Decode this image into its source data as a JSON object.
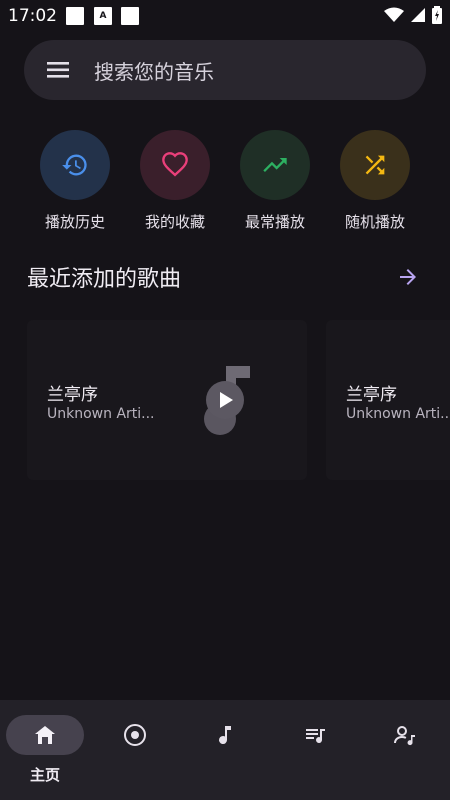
{
  "status_bar": {
    "time": "17:02",
    "icon_a_label": "A"
  },
  "search": {
    "placeholder": "搜索您的音乐"
  },
  "quick_actions": [
    {
      "label": "播放历史",
      "icon": "history-icon",
      "color": "#4a8fea"
    },
    {
      "label": "我的收藏",
      "icon": "heart-icon",
      "color": "#ea3f7a"
    },
    {
      "label": "最常播放",
      "icon": "trending-up-icon",
      "color": "#2db061"
    },
    {
      "label": "随机播放",
      "icon": "shuffle-icon",
      "color": "#f4b812"
    }
  ],
  "recent_section": {
    "title": "最近添加的歌曲",
    "accent": "#b8a4f0"
  },
  "songs": [
    {
      "title": "兰亭序",
      "artist": "Unknown Arti..."
    },
    {
      "title": "兰亭序",
      "artist": "Unknown Arti..."
    }
  ],
  "bottom_nav": {
    "items": [
      {
        "label": "主页",
        "icon": "home-icon",
        "active": true
      },
      {
        "label": "",
        "icon": "album-icon"
      },
      {
        "label": "",
        "icon": "music-note-icon"
      },
      {
        "label": "",
        "icon": "playlist-icon"
      },
      {
        "label": "",
        "icon": "artist-icon"
      }
    ]
  }
}
